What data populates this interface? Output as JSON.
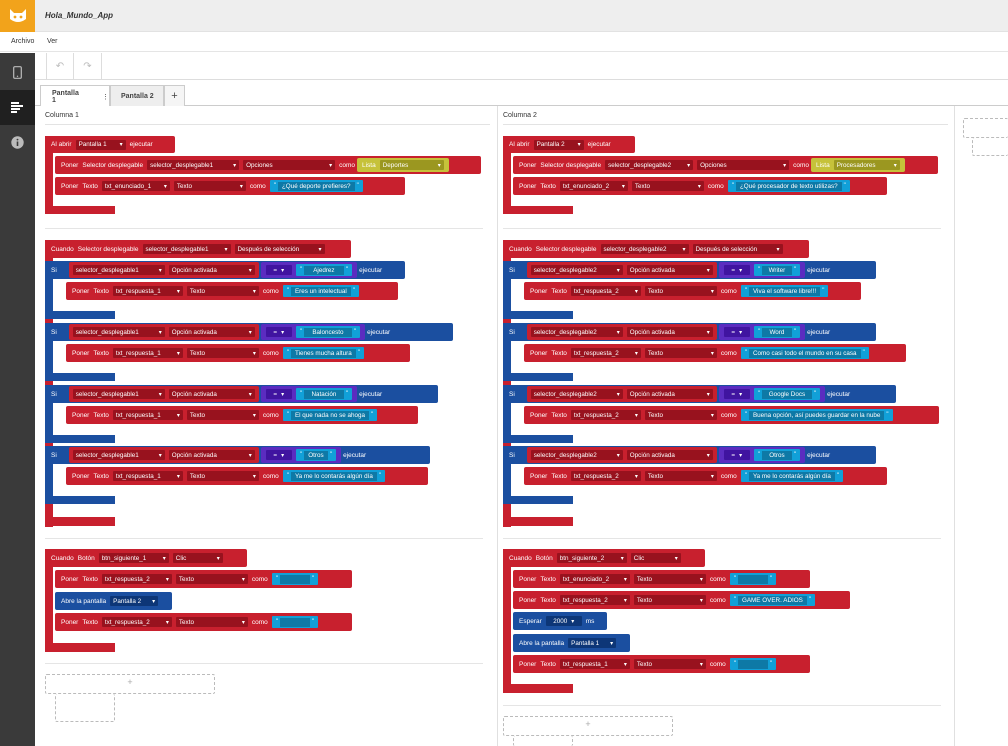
{
  "app": {
    "title": "Hola_Mundo_App"
  },
  "menu": {
    "file": "Archivo",
    "view": "Ver"
  },
  "tabs": [
    {
      "label": "Pantalla 1"
    },
    {
      "label": "Pantalla 2"
    }
  ],
  "tab_more": "⋮",
  "tab_add": "+",
  "columns": {
    "c1": "Columna 1",
    "c2": "Columna 2"
  },
  "kw": {
    "al_abrir": "Al abrir",
    "ejecutar": "ejecutar",
    "poner": "Poner",
    "como": "como",
    "lista": "Lista",
    "cuando": "Cuando",
    "selector": "Selector desplegable",
    "si": "Si",
    "texto": "Texto",
    "boton": "Botón",
    "abre": "Abre la pantalla",
    "esperar": "Esperar",
    "ms": "ms",
    "eq": "="
  },
  "p1": {
    "screen": "Pantalla 1",
    "sel": "selector_desplegable1",
    "opciones": "Opciones",
    "deportes": "Deportes",
    "enun": "txt_enunciado_1",
    "texto": "Texto",
    "pregunta": "¿Qué deporte prefieres?",
    "despues": "Después de selección",
    "opcion": "Opción activada",
    "resp": "txt_respuesta_1",
    "conds": [
      {
        "v": "Ajedrez",
        "r": "Eres un intelectual"
      },
      {
        "v": "Baloncesto",
        "r": "Tienes mucha altura"
      },
      {
        "v": "Natación",
        "r": "El que nada no se ahoga"
      },
      {
        "v": "Otros",
        "r": "Ya me lo contarás algún día"
      }
    ],
    "btn": "btn_siguiente_1",
    "clic": "Clic",
    "resp2": "txt_respuesta_2",
    "abre": "Pantalla 2"
  },
  "p2": {
    "screen": "Pantalla 2",
    "sel": "selector_desplegable2",
    "opciones": "Opciones",
    "proc": "Procesadores",
    "enun": "txt_enunciado_2",
    "texto": "Texto",
    "pregunta": "¿Qué procesador de texto utilizas?",
    "despues": "Después de selección",
    "opcion": "Opción activada",
    "resp": "txt_respuesta_2",
    "conds": [
      {
        "v": "Writer",
        "r": "Viva el software libre!!!"
      },
      {
        "v": "Word",
        "r": "Como casi todo el mundo en su casa"
      },
      {
        "v": "Google Docs",
        "r": "Buena opción, así puedes guardar en la nube"
      },
      {
        "v": "Otros",
        "r": "Ya me lo contarás algún día"
      }
    ],
    "btn": "btn_siguiente_2",
    "clic": "Clic",
    "gameover": "GAME OVER. ADIOS",
    "ms": "2000",
    "abre": "Pantalla 1",
    "resp1": "txt_respuesta_1"
  },
  "colors": {
    "logo": "#f2a31b",
    "red": "#c8202e",
    "blue": "#1b4fa0",
    "purple": "#5b2cc0",
    "cyan": "#11a0d8",
    "yellow": "#c6c23a"
  },
  "icons": {
    "logo": "cat-logo-icon",
    "phone": "phone-icon",
    "blocks": "blocks-icon",
    "info": "info-icon",
    "undo": "undo-icon",
    "redo": "redo-icon"
  }
}
